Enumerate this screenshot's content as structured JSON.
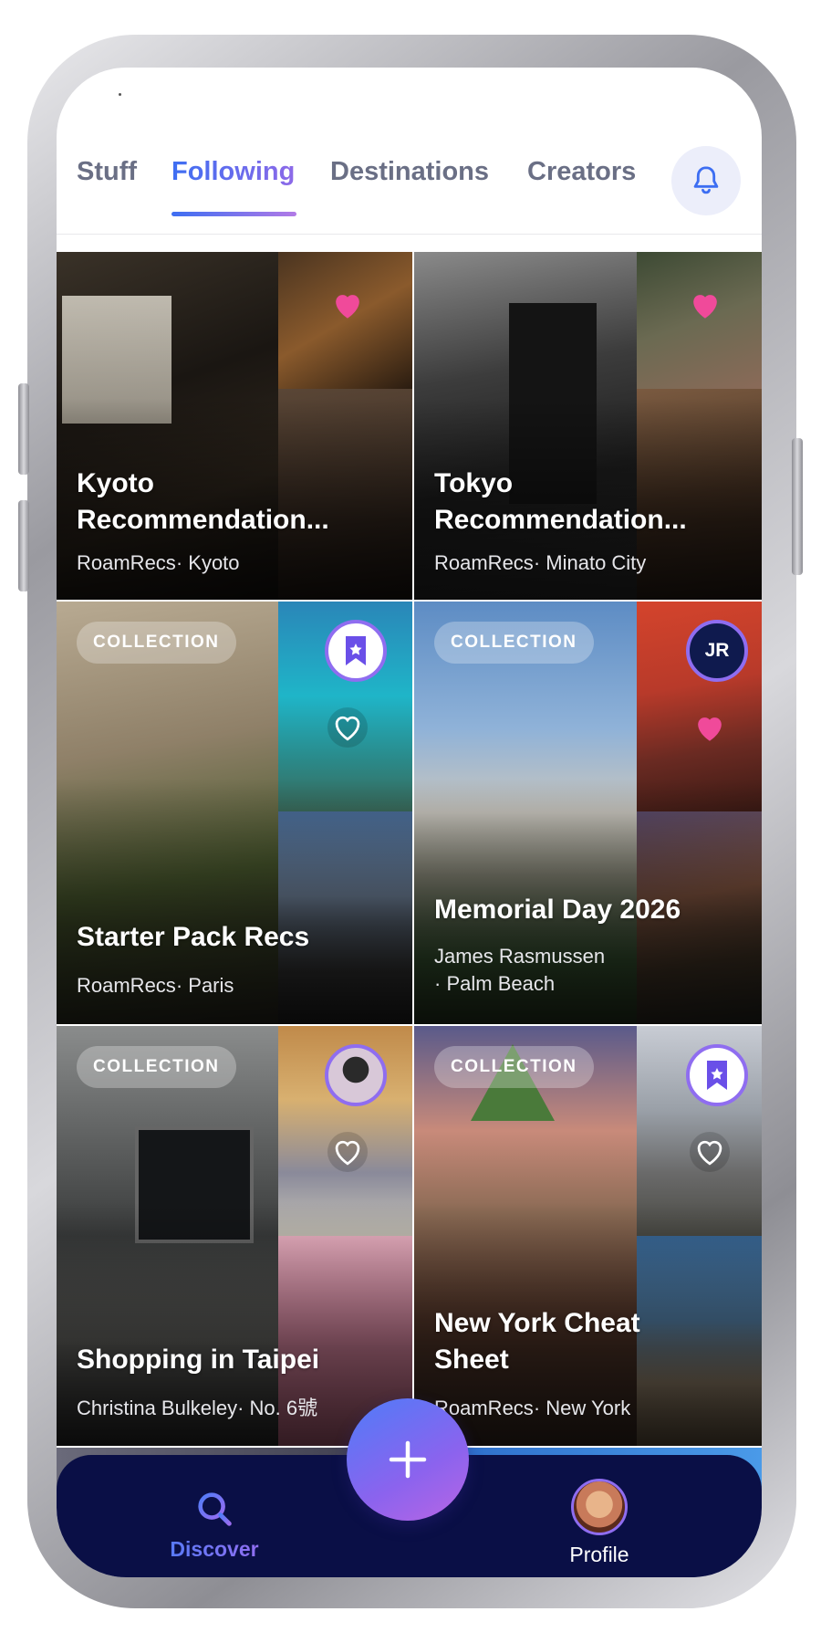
{
  "tabs": {
    "items": [
      {
        "label": "Stuff",
        "active": false
      },
      {
        "label": "Following",
        "active": true
      },
      {
        "label": "Destinations",
        "active": false
      },
      {
        "label": "Creators",
        "active": false
      }
    ],
    "bell_icon": "bell-icon"
  },
  "cards": [
    {
      "title": "Kyoto Recommendation...",
      "author": "RoamRecs",
      "location": "Kyoto",
      "badge": "",
      "liked": true
    },
    {
      "title": "Tokyo Recommendation...",
      "author": "RoamRecs",
      "location": "Minato City",
      "badge": "",
      "liked": true
    },
    {
      "title": "Starter Pack Recs",
      "author": "RoamRecs",
      "location": "Paris",
      "badge": "COLLECTION",
      "liked": false,
      "owner_icon": "bookmark-icon"
    },
    {
      "title": "Memorial Day 2026",
      "author": "James Rasmussen",
      "location": "Palm Beach",
      "badge": "COLLECTION",
      "liked": true,
      "owner_initials": "JR"
    },
    {
      "title": "Shopping in Taipei",
      "author": "Christina Bulkeley",
      "location": "No. 6號",
      "badge": "COLLECTION",
      "liked": false,
      "owner_icon": "avatar-photo"
    },
    {
      "title": "New York Cheat Sheet",
      "author": "RoamRecs",
      "location": "New York",
      "badge": "COLLECTION",
      "liked": false,
      "owner_icon": "bookmark-icon"
    }
  ],
  "bottom_nav": {
    "discover_label": "Discover",
    "profile_label": "Profile",
    "add_icon": "plus-icon"
  },
  "colors": {
    "accent_blue": "#3d6ef2",
    "accent_purple": "#8d6ae8",
    "heart_pink": "#f04a9a",
    "nav_bg": "#0a0f46"
  }
}
